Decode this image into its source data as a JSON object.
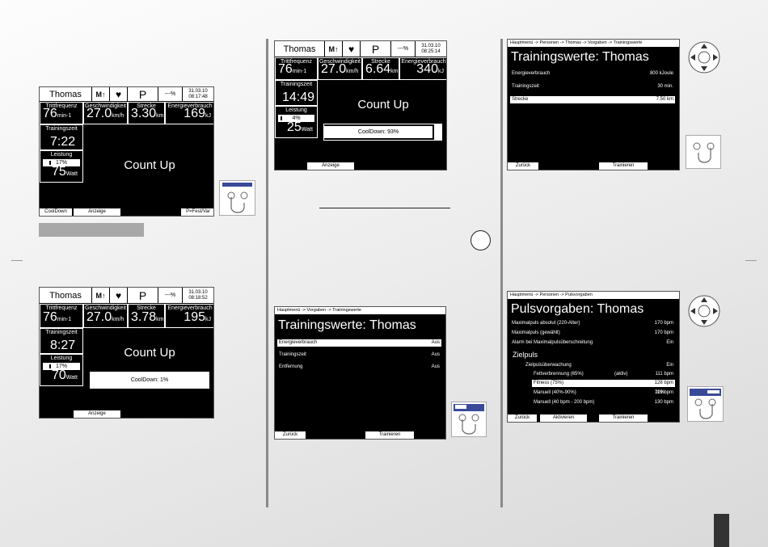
{
  "colors": {
    "screen_bg": "#000000",
    "screen_fg": "#ffffff",
    "page_bg": "#e8e8e8",
    "rule": "#8a8a8a",
    "highlight": "#2a3a8c"
  },
  "screen1": {
    "user": "Thomas",
    "program": "P",
    "pct": "---%",
    "date": "31.03.10",
    "time": "08:17:48",
    "m1": {
      "label": "Trittfrequenz",
      "value": "76",
      "unit": "min-1"
    },
    "m2": {
      "label": "Geschwindigkeit",
      "value": "27.0",
      "unit": "km/h"
    },
    "m3": {
      "label": "Strecke",
      "value": "3.30",
      "unit": "km"
    },
    "m4": {
      "label": "Energieverbrauch",
      "value": "169",
      "unit": "kJ"
    },
    "m5": {
      "label": "Trainingszeit",
      "value": "7:22"
    },
    "m6": {
      "label": "Leistung",
      "bar": "17%",
      "value": "75",
      "unit": "Watt"
    },
    "mode": "Count Up",
    "soft1": "CoolDown",
    "soft2": "Anzeige",
    "soft3": "P=Fest/Var"
  },
  "screen2": {
    "user": "Thomas",
    "program": "P",
    "pct": "---%",
    "date": "31.03.10",
    "time": "08:18:52",
    "m1": {
      "label": "Trittfrequenz",
      "value": "76",
      "unit": "min-1"
    },
    "m2": {
      "label": "Geschwindigkeit",
      "value": "27.0",
      "unit": "km/h"
    },
    "m3": {
      "label": "Strecke",
      "value": "3.78",
      "unit": "km"
    },
    "m4": {
      "label": "Energieverbrauch",
      "value": "195",
      "unit": "kJ"
    },
    "m5": {
      "label": "Trainingszeit",
      "value": "8:27"
    },
    "m6": {
      "label": "Leistung",
      "bar": "17%",
      "value": "70",
      "unit": "Watt"
    },
    "mode": "Count Up",
    "cooldown": "CoolDown: 1%",
    "soft2": "Anzeige"
  },
  "screen3": {
    "user": "Thomas",
    "program": "P",
    "pct": "---%",
    "date": "31.03.10",
    "time": "08:25:14",
    "m1": {
      "label": "Trittfrequenz",
      "value": "76",
      "unit": "min-1"
    },
    "m2": {
      "label": "Geschwindigkeit",
      "value": "27.0",
      "unit": "km/h"
    },
    "m3": {
      "label": "Strecke",
      "value": "6.64",
      "unit": "km"
    },
    "m4": {
      "label": "Energieverbrauch",
      "value": "340",
      "unit": "kJ"
    },
    "m5": {
      "label": "Trainingszeit",
      "value": "14:49"
    },
    "m6": {
      "label": "Leistung",
      "bar": "4%",
      "value": "25",
      "unit": "Watt"
    },
    "mode": "Count Up",
    "cooldown": "CoolDown: 93%",
    "soft2": "Anzeige"
  },
  "screen4": {
    "crumb": "Hauptmenü -> Vorgaben -> Trainingswerte",
    "title": "Trainingswerte: Thomas",
    "rows": [
      {
        "k": "Energieverbrauch",
        "v": "Aus"
      },
      {
        "k": "Trainingszeit",
        "v": "Aus"
      },
      {
        "k": "Entfernung",
        "v": "Aus"
      }
    ],
    "soft1": "Zurück",
    "soft2": "Trainieren"
  },
  "screen5": {
    "crumb": "Hauptmenü -> Personen -> Thomas -> Vorgaben -> Trainingswerte",
    "title": "Trainingswerte: Thomas",
    "rows": [
      {
        "k": "Energieverbrauch",
        "v": "800 kJoule"
      },
      {
        "k": "Trainingszeit",
        "v": "30 min."
      },
      {
        "k": "Strecke",
        "v": "7.50 km"
      }
    ],
    "soft1": "Zurück",
    "soft2": "Trainieren"
  },
  "screen6": {
    "crumb": "Hauptmenü -> Personen -> Pulsvorgaben",
    "title": "Pulsvorgaben: Thomas",
    "rows": [
      {
        "k": "Maximalpuls absolut (220-Alter)",
        "v": "170 bpm"
      },
      {
        "k": "Maximalpuls (gewählt)",
        "v": "170 bpm"
      },
      {
        "k": "Alarm bei Maximalpulsüberschreitung",
        "v": "Ein"
      }
    ],
    "zielpuls": "Zielpuls",
    "zrows": [
      {
        "k": "Zielpulsüberwachung",
        "v": "Ein"
      },
      {
        "k": "Fettverbrennung (65%)",
        "m": "(aktiv)",
        "v": "111 bpm"
      },
      {
        "k": "Fitness (75%)",
        "v": "128 bpm"
      },
      {
        "k": "Manuell (40%-90%)",
        "m": "70%",
        "v": "119 bpm"
      },
      {
        "k": "Manuell (40 bpm - 200 bpm)",
        "v": "130 bpm"
      }
    ],
    "soft1": "Zurück",
    "soft2": "Aktivieren",
    "soft3": "Trainieren"
  },
  "page_number": "",
  "page_marker": ""
}
